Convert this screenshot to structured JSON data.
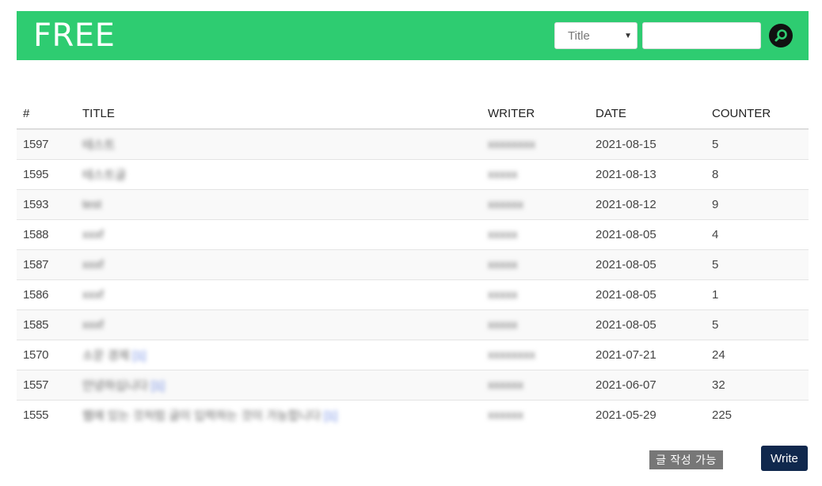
{
  "header": {
    "brand": "FREE",
    "search_select_value": "Title",
    "search_placeholder": "",
    "bg_color": "#2ecc71"
  },
  "table": {
    "columns": [
      "#",
      "TITLE",
      "WRITER",
      "DATE",
      "COUNTER"
    ],
    "rows": [
      {
        "num": "1597",
        "title": "테스트",
        "tag": "",
        "writer": "xxxxxxxx",
        "date": "2021-08-15",
        "counter": "5"
      },
      {
        "num": "1595",
        "title": "테스트글",
        "tag": "",
        "writer": "xxxxx",
        "date": "2021-08-13",
        "counter": "8"
      },
      {
        "num": "1593",
        "title": "test",
        "tag": "",
        "writer": "xxxxxx",
        "date": "2021-08-12",
        "counter": "9"
      },
      {
        "num": "1588",
        "title": "xxxf",
        "tag": "",
        "writer": "xxxxx",
        "date": "2021-08-05",
        "counter": "4"
      },
      {
        "num": "1587",
        "title": "xxxf",
        "tag": "",
        "writer": "xxxxx",
        "date": "2021-08-05",
        "counter": "5"
      },
      {
        "num": "1586",
        "title": "xxxf",
        "tag": "",
        "writer": "xxxxx",
        "date": "2021-08-05",
        "counter": "1"
      },
      {
        "num": "1585",
        "title": "xxxf",
        "tag": "",
        "writer": "xxxxx",
        "date": "2021-08-05",
        "counter": "5"
      },
      {
        "num": "1570",
        "title": "소문 경제",
        "tag": "[1]",
        "writer": "xxxxxxxx",
        "date": "2021-07-21",
        "counter": "24"
      },
      {
        "num": "1557",
        "title": "안녕하십니다",
        "tag": "[1]",
        "writer": "xxxxxx",
        "date": "2021-06-07",
        "counter": "32"
      },
      {
        "num": "1555",
        "title": "웹에 있는 것처럼 글이 입력하는 것이 가능합니다",
        "tag": "[1]",
        "writer": "xxxxxx",
        "date": "2021-05-29",
        "counter": "225"
      }
    ]
  },
  "footer": {
    "notice": "글 작성 가능",
    "write_label": "Write"
  },
  "icons": {
    "search": "search-icon"
  }
}
